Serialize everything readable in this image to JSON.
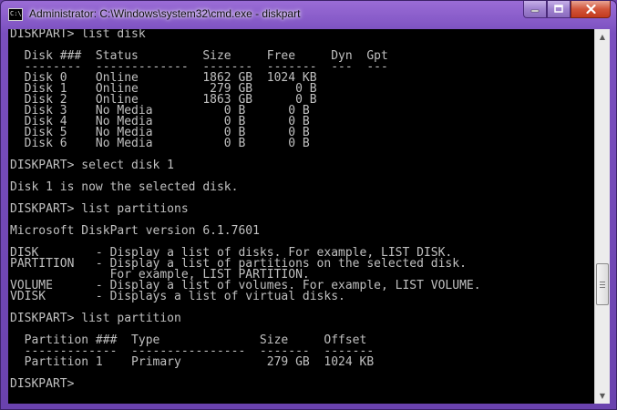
{
  "window": {
    "title": "Administrator: C:\\Windows\\system32\\cmd.exe - diskpart",
    "icon": "cmd-console-icon",
    "app_icon_text": "C:\\.",
    "buttons": {
      "minimize": "minimize-icon",
      "maximize": "maximize-icon",
      "close": "close-icon"
    }
  },
  "console": {
    "lines": [
      "DISKPART> list disk",
      "",
      "  Disk ###  Status         Size     Free     Dyn  Gpt",
      "  --------  -------------  -------  -------  ---  ---",
      "  Disk 0    Online         1862 GB  1024 KB",
      "  Disk 1    Online          279 GB      0 B",
      "  Disk 2    Online         1863 GB      0 B",
      "  Disk 3    No Media          0 B      0 B",
      "  Disk 4    No Media          0 B      0 B",
      "  Disk 5    No Media          0 B      0 B",
      "  Disk 6    No Media          0 B      0 B",
      "",
      "DISKPART> select disk 1",
      "",
      "Disk 1 is now the selected disk.",
      "",
      "DISKPART> list partitions",
      "",
      "Microsoft DiskPart version 6.1.7601",
      "",
      "DISK        - Display a list of disks. For example, LIST DISK.",
      "PARTITION   - Display a list of partitions on the selected disk.",
      "              For example, LIST PARTITION.",
      "VOLUME      - Display a list of volumes. For example, LIST VOLUME.",
      "VDISK       - Displays a list of virtual disks.",
      "",
      "DISKPART> list partition",
      "",
      "  Partition ###  Type              Size     Offset",
      "  -------------  ----------------  -------  -------",
      "  Partition 1    Primary            279 GB  1024 KB",
      "",
      "DISKPART> "
    ]
  },
  "scrollbar": {
    "up_arrow": "▲",
    "down_arrow": "▼"
  },
  "colors": {
    "console_bg": "#000000",
    "console_fg": "#c0c0c0",
    "titlebar": "#7a4fbf",
    "close_button": "#c33b1d"
  }
}
